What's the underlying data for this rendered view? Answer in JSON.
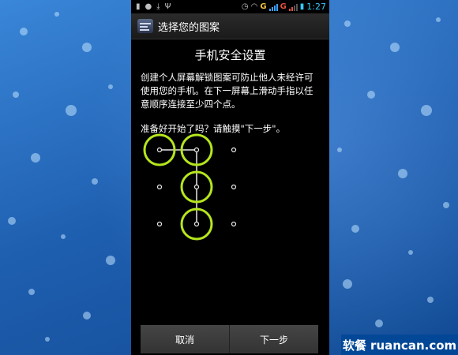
{
  "status_bar": {
    "network_1": "G",
    "network_2": "G",
    "time": "1:27"
  },
  "title_bar": {
    "title": "选择您的图案"
  },
  "content": {
    "heading": "手机安全设置",
    "description": "创建个人屏幕解锁图案可防止他人未经许可使用您的手机。在下一屏幕上滑动手指以任意顺序连接至少四个点。",
    "prompt": "准备好开始了吗？请触摸\"下一步\"。"
  },
  "pattern_demo": {
    "grid": "3x3",
    "path": [
      1,
      2,
      5,
      8
    ],
    "highlight_color": "#b5e61d"
  },
  "buttons": {
    "cancel": "取消",
    "next": "下一步"
  },
  "watermark": {
    "text": "软餐 ruancan.com"
  }
}
